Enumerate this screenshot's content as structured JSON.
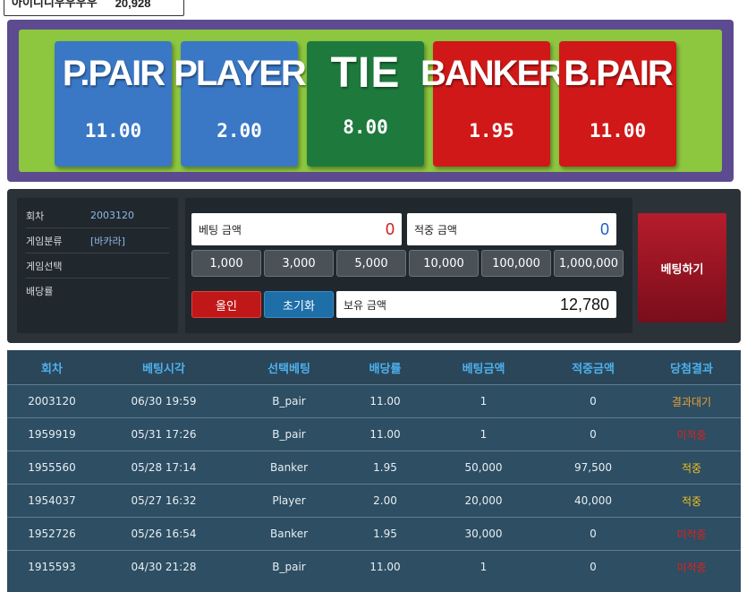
{
  "top_box": {
    "label": "아이디디우우우우",
    "value": "20,928"
  },
  "odds": [
    {
      "name": "P.PAIR",
      "value": "11.00",
      "color": "#3a78c6"
    },
    {
      "name": "PLAYER",
      "value": "2.00",
      "color": "#3a78c6"
    },
    {
      "name": "TIE",
      "value": "8.00",
      "color": "#1e7a3c"
    },
    {
      "name": "BANKER",
      "value": "1.95",
      "color": "#d01818"
    },
    {
      "name": "B.PAIR",
      "value": "11.00",
      "color": "#d01818"
    }
  ],
  "info": [
    {
      "label": "회차",
      "value": "2003120"
    },
    {
      "label": "게임분류",
      "value": "[바카라]"
    },
    {
      "label": "게임선택",
      "value": ""
    },
    {
      "label": "배당률",
      "value": ""
    }
  ],
  "bet": {
    "bet_amount_label": "베팅 금액",
    "bet_amount_value": "0",
    "win_amount_label": "적중 금액",
    "win_amount_value": "0",
    "amount_buttons": [
      "1,000",
      "3,000",
      "5,000",
      "10,000",
      "100,000",
      "1,000,000"
    ],
    "allin_label": "올인",
    "reset_label": "초기화",
    "balance_label": "보유 금액",
    "balance_value": "12,780",
    "submit_label": "베팅하기"
  },
  "history": {
    "headers": [
      "회차",
      "베팅시각",
      "선택베팅",
      "배당률",
      "베팅금액",
      "적중금액",
      "당첨결과"
    ],
    "rows": [
      [
        "2003120",
        "06/30 19:59",
        "B_pair",
        "11.00",
        "1",
        "0",
        "결과대기"
      ],
      [
        "1959919",
        "05/31 17:26",
        "B_pair",
        "11.00",
        "1",
        "0",
        "미적중"
      ],
      [
        "1955560",
        "05/28 17:14",
        "Banker",
        "1.95",
        "50,000",
        "97,500",
        "적중"
      ],
      [
        "1954037",
        "05/27 16:32",
        "Player",
        "2.00",
        "20,000",
        "40,000",
        "적중"
      ],
      [
        "1952726",
        "05/26 16:54",
        "Banker",
        "1.95",
        "30,000",
        "0",
        "미적중"
      ],
      [
        "1915593",
        "04/30 21:28",
        "B_pair",
        "11.00",
        "1",
        "0",
        "미적중"
      ]
    ],
    "result_colors": {
      "결과대기": "#f0a030",
      "미적중": "#e02020",
      "적중": "#f0c020"
    }
  }
}
